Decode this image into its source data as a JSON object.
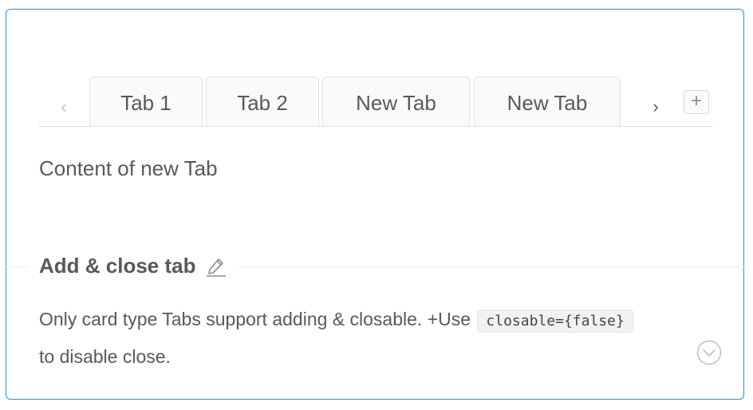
{
  "tabs": {
    "prev_arrow": "‹",
    "next_arrow": "›",
    "add_label": "+",
    "items": [
      {
        "label": "Tab 1"
      },
      {
        "label": "Tab 2"
      },
      {
        "label": "New Tab"
      },
      {
        "label": "New Tab"
      },
      {
        "label": ""
      }
    ]
  },
  "content": {
    "text": "Content of new Tab"
  },
  "section": {
    "title": "Add & close tab",
    "edit_icon": "edit-icon",
    "description_prefix": "Only card type Tabs support adding & closable. +Use",
    "code": "closable={false}",
    "description_suffix": "to disable close.",
    "expand_icon": "expand-code-icon"
  },
  "colors": {
    "accent": "#1890ff",
    "text": "#595959",
    "border": "#e3e3e3"
  }
}
